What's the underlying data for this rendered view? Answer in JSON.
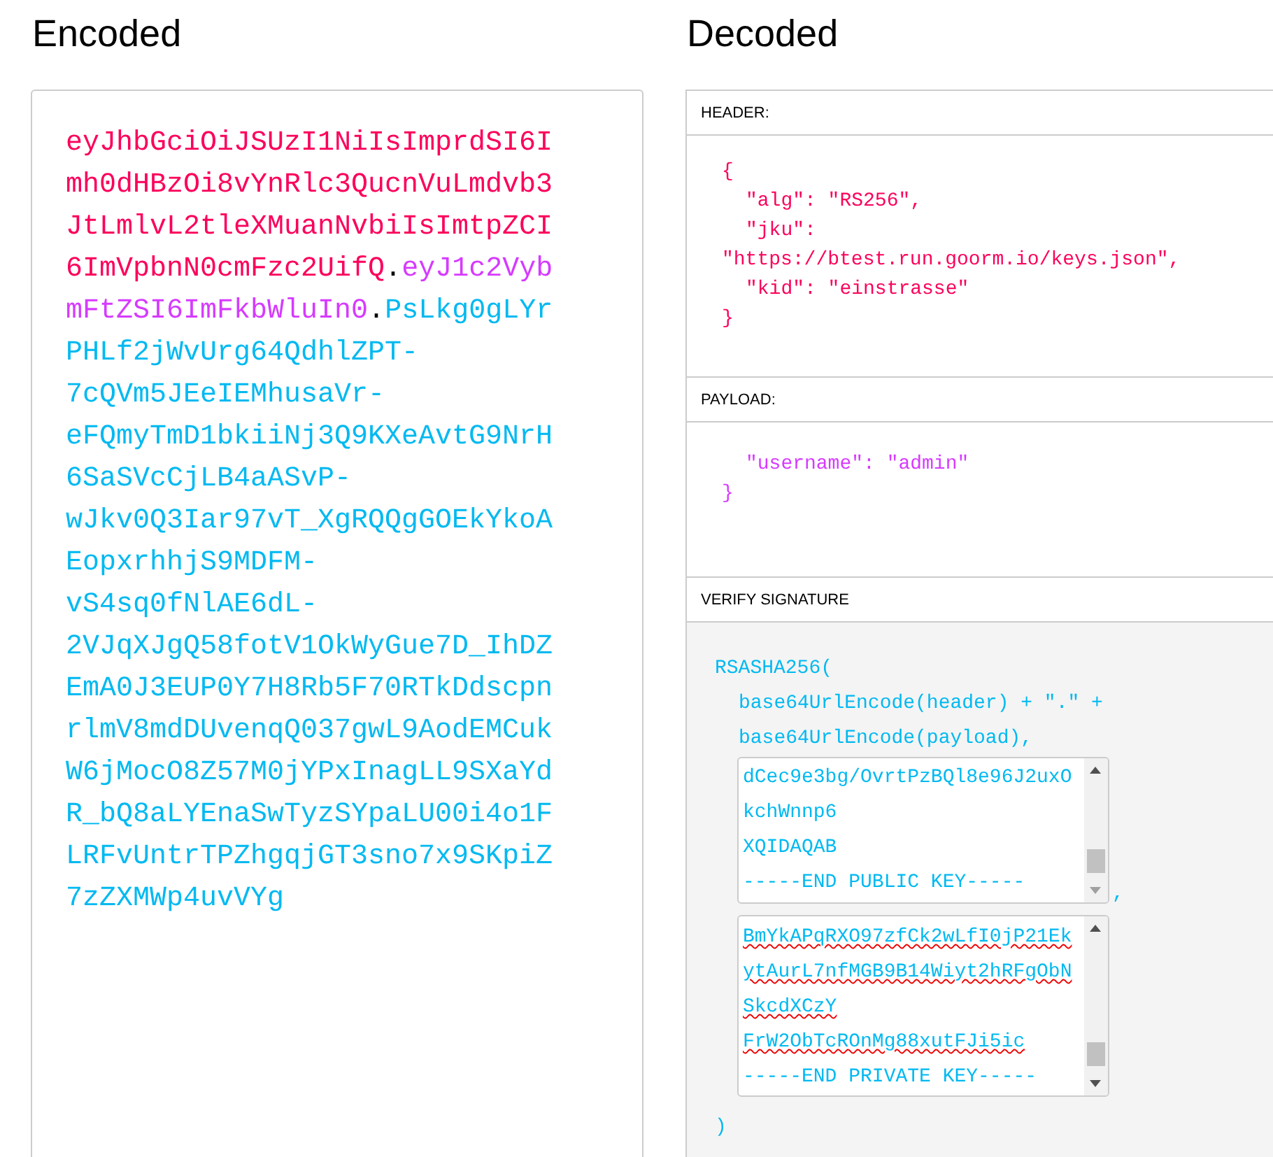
{
  "encoded": {
    "title": "Encoded",
    "separator": ".",
    "segments": [
      {
        "text": "eyJhbGciOiJSUzI1NiIsImprdSI6Imh0dHBzOi8vYnRlc3QucnVuLmdvb3JtLmlvL2tleXMuanNvbiIsImtpZCI6ImVpbnN0cmFzc2UifQ",
        "color": "#fb015b"
      },
      {
        "text": "eyJ1c2VybmFtZSI6ImFkbWluIn0",
        "color": "#d63aff"
      },
      {
        "text": "PsLkg0gLYrPHLf2jWvUrg64QdhlZPT-7cQVm5JEeIEMhusaVr-eFQmyTmD1bkiiNj3Q9KXeAvtG9NrH6SaSVcCjLB4aASvP-wJkv0Q3Iar97vT_XgRQQgGOEkYkoAEopxrhhjS9MDFM-vS4sq0fNlAE6dL-2VJqXJgQ58fotV1OkWyGue7D_IhDZEmA0J3EUP0Y7H8Rb5F70RTkDdscpnrlmV8mdDUvenqQ037gwL9AodEMCukW6jMocO8Z57M0jYPxInagLL9SXaYdR_bQ8aLYEnaSwTyzSYpaLU00i4o1FLRFvUntrTPZhgqjGT3sno7x9SKpiZ7zZXMWp4uvVYg",
        "color": "#00b9f1"
      }
    ]
  },
  "decoded": {
    "title": "Decoded",
    "header": {
      "label": "HEADER:",
      "color": "#fb015b",
      "lines": [
        {
          "text": "{",
          "kind": "brace"
        },
        {
          "text": "\"alg\": \"RS256\",",
          "kind": "entry"
        },
        {
          "text": "\"jku\":",
          "kind": "entry"
        },
        {
          "text": "\"https://btest.run.goorm.io/keys.json\",",
          "kind": "wrapped"
        },
        {
          "text": "\"kid\": \"einstrasse\"",
          "kind": "entry"
        },
        {
          "text": "}",
          "kind": "brace"
        }
      ]
    },
    "payload": {
      "label": "PAYLOAD:",
      "color": "#d63aff",
      "lines": [
        {
          "text": "\"username\": \"admin\"",
          "kind": "entry"
        },
        {
          "text": "}",
          "kind": "brace"
        }
      ]
    },
    "verify": {
      "label": "VERIFY SIGNATURE",
      "color": "#00b9f1",
      "opening": "RSASHA256(",
      "args": [
        "base64UrlEncode(header) + \".\" +",
        "base64UrlEncode(payload),"
      ],
      "public_key": {
        "lines": [
          "dCec9e3bg/OvrtPzBQl8e96J2uxO",
          "kchWnnp6",
          "XQIDAQAB",
          "-----END PUBLIC KEY-----"
        ],
        "misspelled": false
      },
      "comma": ",",
      "private_key": {
        "lines": [
          "BmYkAPqRXO97zfCk2wLfI0jP21Ek",
          "ytAurL7nfMGB9B14Wiyt2hRFgObN",
          "SkcdXCzY",
          "FrW2ObTcROnMg88xutFJi5ic",
          "-----END PRIVATE KEY-----"
        ],
        "misspelled": true
      },
      "closing": ")"
    }
  }
}
